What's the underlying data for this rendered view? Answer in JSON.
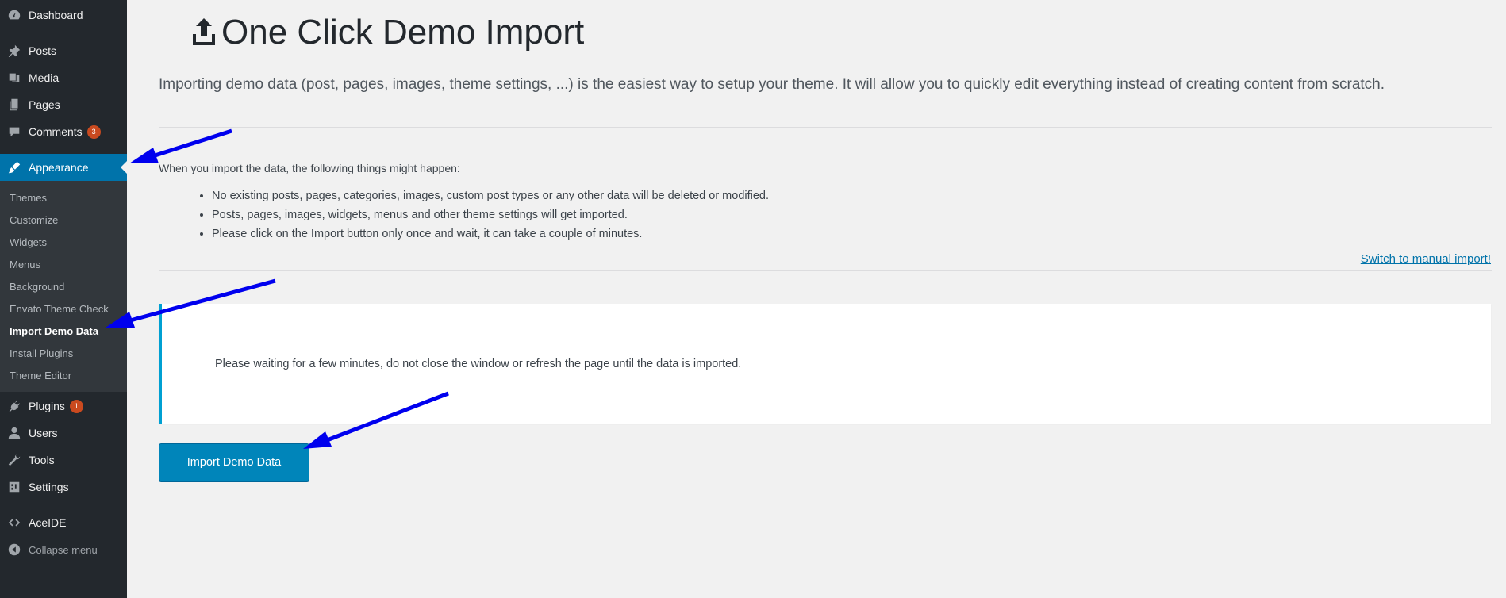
{
  "sidebar": {
    "menu": [
      {
        "label": "Dashboard",
        "icon": "dashboard-icon"
      },
      {
        "label": "Posts",
        "icon": "pin-icon"
      },
      {
        "label": "Media",
        "icon": "media-icon"
      },
      {
        "label": "Pages",
        "icon": "pages-icon"
      },
      {
        "label": "Comments",
        "icon": "comment-icon",
        "badge": "3"
      },
      {
        "label": "Appearance",
        "icon": "paintbrush-icon"
      },
      {
        "label": "Plugins",
        "icon": "plug-icon",
        "badge": "1"
      },
      {
        "label": "Users",
        "icon": "user-icon"
      },
      {
        "label": "Tools",
        "icon": "wrench-icon"
      },
      {
        "label": "Settings",
        "icon": "settings-icon"
      },
      {
        "label": "AceIDE",
        "icon": "code-icon"
      },
      {
        "label": "Collapse menu",
        "icon": "collapse-icon"
      }
    ],
    "submenu": [
      "Themes",
      "Customize",
      "Widgets",
      "Menus",
      "Background",
      "Envato Theme Check",
      "Import Demo Data",
      "Install Plugins",
      "Theme Editor"
    ]
  },
  "main": {
    "title": "One Click Demo Import",
    "intro": "Importing demo data (post, pages, images, theme settings, ...) is the easiest way to setup your theme. It will allow you to quickly edit everything instead of creating content from scratch.",
    "lead": "When you import the data, the following things might happen:",
    "bullets": [
      "No existing posts, pages, categories, images, custom post types or any other data will be deleted or modified.",
      "Posts, pages, images, widgets, menus and other theme settings will get imported.",
      "Please click on the Import button only once and wait, it can take a couple of minutes."
    ],
    "switch_link": "Switch to manual import!",
    "notice": "Please waiting for a few minutes, do not close the window or refresh the page until the data is imported.",
    "import_button": "Import Demo Data"
  },
  "colors": {
    "sidebar_bg": "#23282d",
    "submenu_bg": "#32373c",
    "accent": "#0073aa",
    "notice_border": "#00a0d2",
    "badge": "#ca4a1f",
    "annotation_arrow": "#0000ee"
  }
}
